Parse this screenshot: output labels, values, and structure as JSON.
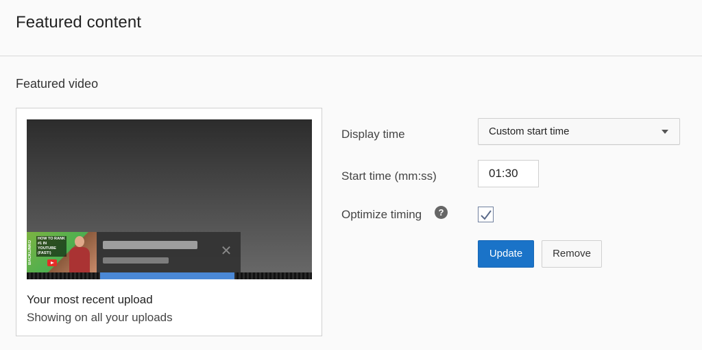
{
  "header": {
    "title": "Featured content"
  },
  "section": {
    "title": "Featured video"
  },
  "card": {
    "thumbnail": {
      "brand": "BACKLINKO",
      "caption": "HOW TO RANK #1 IN YOUTUBE (FAST!)",
      "close_glyph": "✕"
    },
    "upload_title": "Your most recent upload",
    "upload_subtitle": "Showing on all your uploads"
  },
  "form": {
    "display_time_label": "Display time",
    "display_time_value": "Custom start time",
    "start_time_label": "Start time (mm:ss)",
    "start_time_value": "01:30",
    "optimize_label": "Optimize timing",
    "help_glyph": "?",
    "optimize_checked": true,
    "update_label": "Update",
    "remove_label": "Remove"
  },
  "colors": {
    "accent": "#1a73c8",
    "progress": "#4a88d6"
  }
}
